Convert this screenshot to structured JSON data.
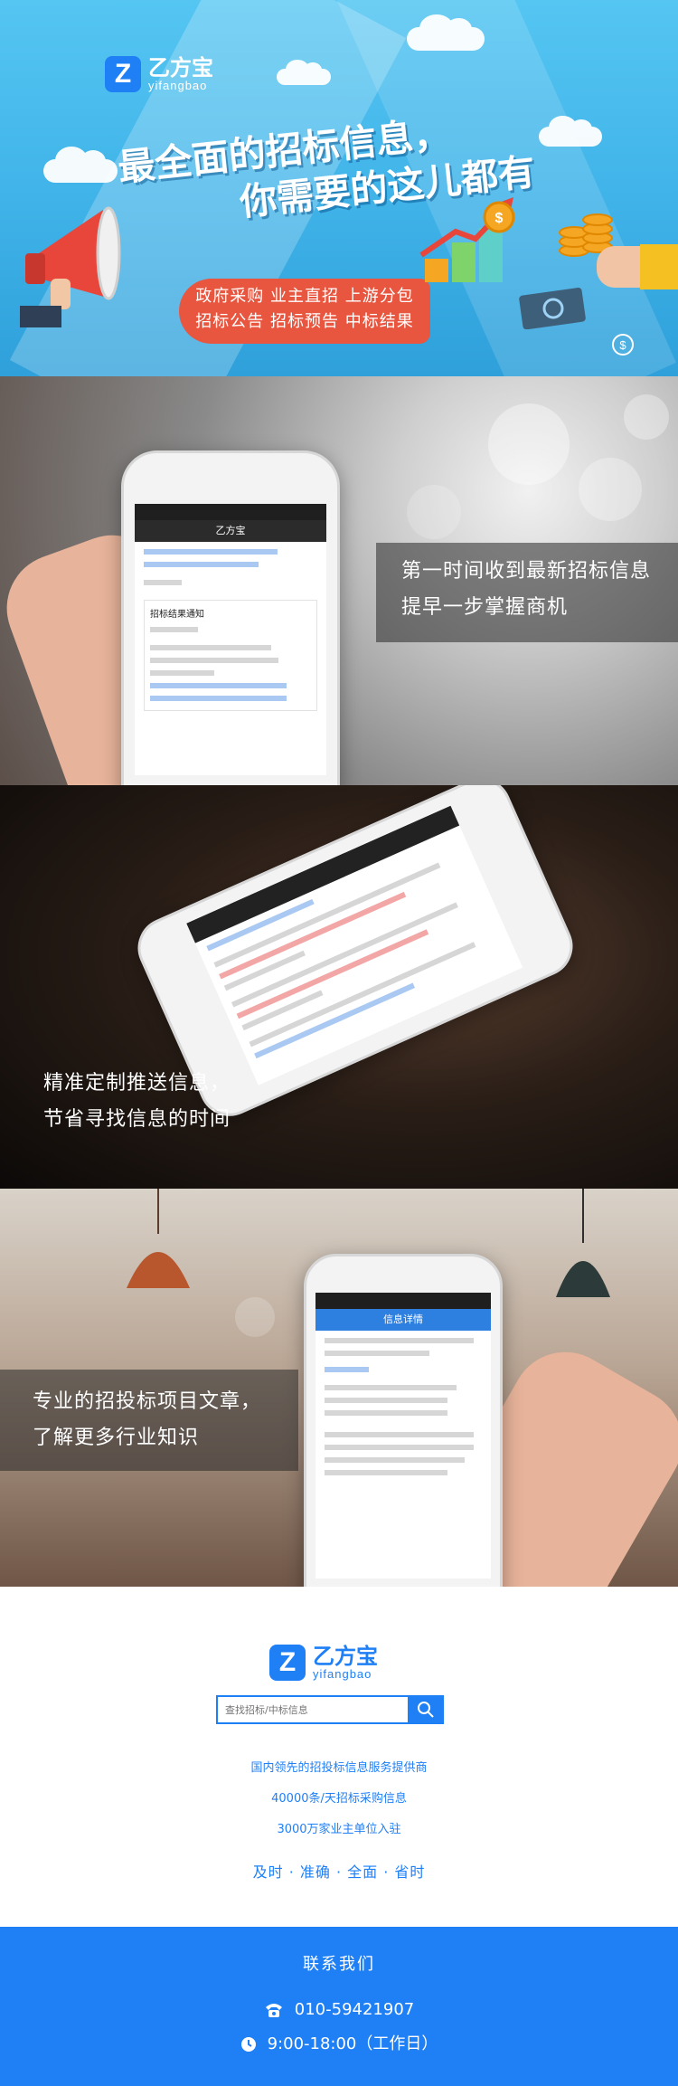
{
  "brand": {
    "name_cn": "乙方宝",
    "name_en": "yifangbao",
    "mark": "Z"
  },
  "hero": {
    "title_line1": "最全面的招标信息，",
    "title_line2": "你需要的这儿都有",
    "tags_line1": "政府采购 业主直招 上游分包",
    "tags_line2": "招标公告 招标预告 中标结果"
  },
  "features": [
    {
      "line1": "第一时间收到最新招标信息",
      "line2": "提早一步掌握商机"
    },
    {
      "line1": "精准定制推送信息，",
      "line2": "节省寻找信息的时间"
    },
    {
      "line1": "专业的招投标项目文章，",
      "line2": "了解更多行业知识"
    }
  ],
  "phone_screens": {
    "screen1_title": "乙方宝",
    "screen1_card": "招标结果通知",
    "screen3_title": "信息详情"
  },
  "search": {
    "placeholder": "查找招标/中标信息"
  },
  "info": {
    "line1": "国内领先的招投标信息服务提供商",
    "line2": "40000条/天招标采购信息",
    "line3": "3000万家业主单位入驻",
    "slogan": "及时 · 准确 · 全面 · 省时"
  },
  "contact": {
    "title": "联系我们",
    "phone": "010-59421907",
    "hours": "9:00-18:00（工作日）"
  },
  "icons": [
    "search-icon",
    "phone-icon",
    "clock-icon",
    "megaphone-icon",
    "coin-icon",
    "cash-icon"
  ],
  "colors": {
    "brand_blue": "#1f7ff5",
    "hero_sky": "#45b9ee",
    "tag_red": "#e8563f"
  }
}
